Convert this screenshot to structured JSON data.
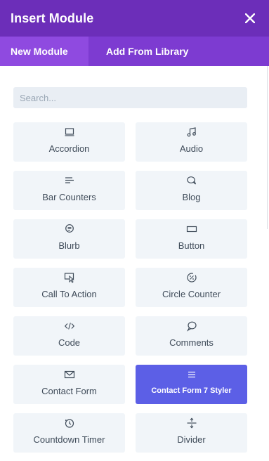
{
  "header": {
    "title": "Insert Module",
    "close_icon": "close-icon"
  },
  "tabs": [
    {
      "label": "New Module",
      "active": true
    },
    {
      "label": "Add From Library",
      "active": false
    }
  ],
  "search": {
    "placeholder": "Search...",
    "value": ""
  },
  "modules": [
    {
      "label": "Accordion",
      "icon": "accordion-icon"
    },
    {
      "label": "Audio",
      "icon": "music-note-icon"
    },
    {
      "label": "Bar Counters",
      "icon": "bar-counters-icon"
    },
    {
      "label": "Blog",
      "icon": "chat-bubbles-icon"
    },
    {
      "label": "Blurb",
      "icon": "blurb-icon"
    },
    {
      "label": "Button",
      "icon": "button-icon"
    },
    {
      "label": "Call To Action",
      "icon": "cursor-click-icon"
    },
    {
      "label": "Circle Counter",
      "icon": "percent-circle-icon"
    },
    {
      "label": "Code",
      "icon": "code-icon"
    },
    {
      "label": "Comments",
      "icon": "comment-icon"
    },
    {
      "label": "Contact Form",
      "icon": "envelope-icon"
    },
    {
      "label": "Contact Form 7 Styler",
      "icon": "menu-lines-icon",
      "selected": true
    },
    {
      "label": "Countdown Timer",
      "icon": "clock-icon"
    },
    {
      "label": "Divider",
      "icon": "divider-icon"
    }
  ],
  "colors": {
    "header_bg": "#6c2eb9",
    "tabs_bg": "#7d3bd1",
    "active_tab_bg": "#8f4ae0",
    "card_bg": "#f1f5f9",
    "selected_card_bg": "#5c5fe6",
    "label_text": "#3f4b59"
  }
}
